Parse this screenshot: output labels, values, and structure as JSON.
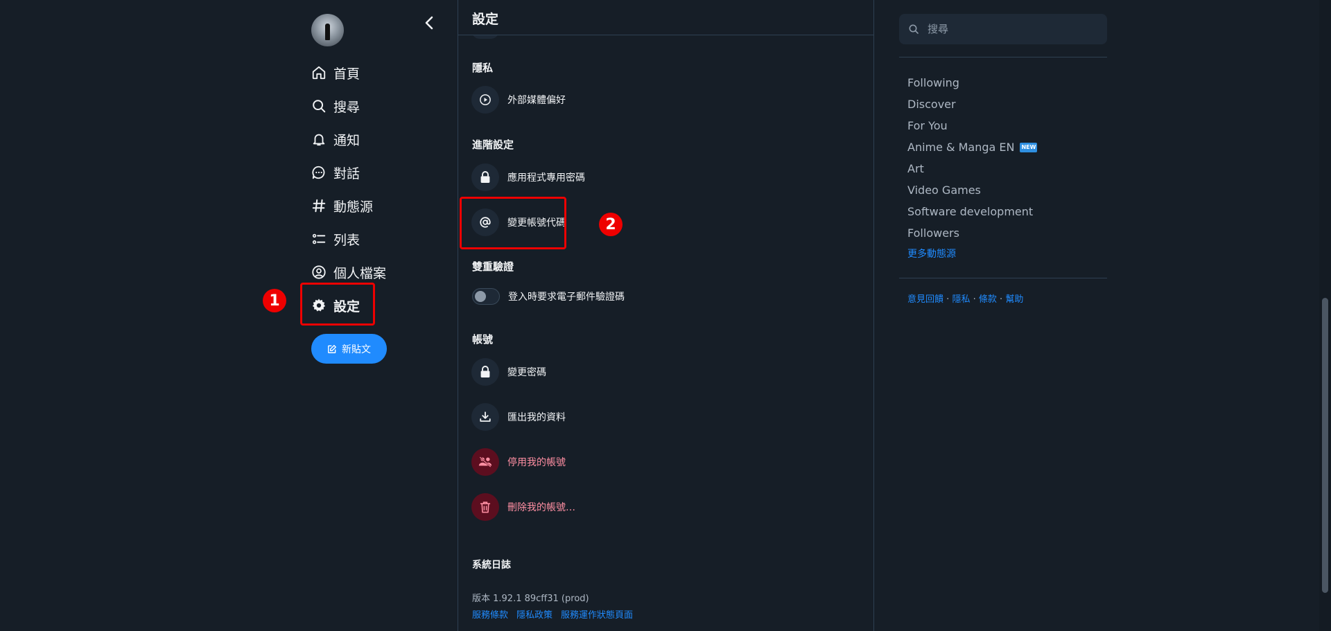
{
  "nav": {
    "items": [
      {
        "label": "首頁",
        "icon": "home-icon"
      },
      {
        "label": "搜尋",
        "icon": "search-icon"
      },
      {
        "label": "通知",
        "icon": "bell-icon"
      },
      {
        "label": "對話",
        "icon": "chat-bubble-icon"
      },
      {
        "label": "動態源",
        "icon": "hashtag-icon"
      },
      {
        "label": "列表",
        "icon": "list-icon"
      },
      {
        "label": "個人檔案",
        "icon": "user-circle-icon"
      },
      {
        "label": "設定",
        "icon": "gear-icon",
        "active": true
      }
    ],
    "new_post_label": "新貼文"
  },
  "header": {
    "title": "設定"
  },
  "sections": {
    "privacy": {
      "heading": "隱私",
      "external_media": "外部媒體偏好"
    },
    "advanced": {
      "heading": "進階設定",
      "app_passwords": "應用程式專用密碼",
      "change_handle": "變更帳號代碼"
    },
    "two_factor": {
      "heading": "雙重驗證",
      "email_code_toggle": "登入時要求電子郵件驗證碼",
      "toggle_on": false
    },
    "account": {
      "heading": "帳號",
      "change_password": "變更密碼",
      "export_data": "匯出我的資料",
      "deactivate": "停用我的帳號",
      "delete": "刪除我的帳號…"
    },
    "system_log": {
      "heading": "系統日誌"
    }
  },
  "footer": {
    "version": "版本 1.92.1 89cff31 (prod)",
    "links": [
      "服務條款",
      "隱私政策",
      "服務運作狀態頁面"
    ]
  },
  "right": {
    "search_placeholder": "搜尋",
    "feeds": [
      "Following",
      "Discover",
      "For You",
      "Anime & Manga EN",
      "Art",
      "Video Games",
      "Software development",
      "Followers"
    ],
    "new_badge": "NEW",
    "more_feeds": "更多動態源",
    "footer_links": [
      "意見回饋",
      "隱私",
      "條款",
      "幫助"
    ],
    "footer_sep": "·"
  },
  "annotations": [
    "1",
    "2"
  ],
  "colors": {
    "accent": "#208bfe",
    "danger": "#ff8fa3",
    "annotation": "#ee0000",
    "background": "#161e27"
  }
}
